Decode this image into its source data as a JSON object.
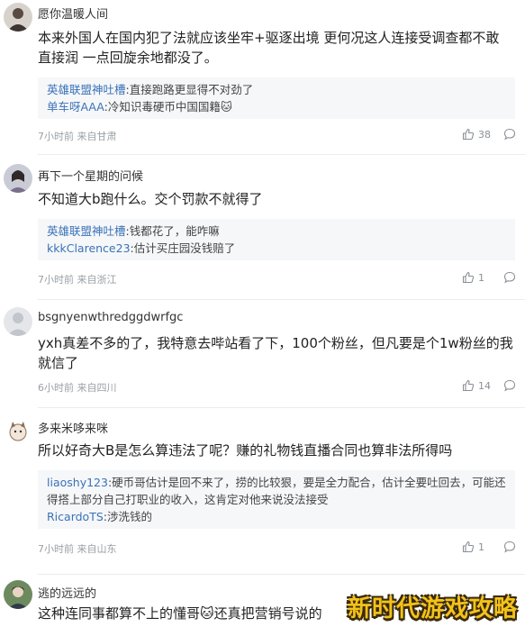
{
  "comments": [
    {
      "username": "愿你温暖人间",
      "text": "本来外国人在国内犯了法就应该坐牢+驱逐出境 更何况这人连接受调查都不敢 直接润 一点回旋余地都没了。",
      "replies": [
        {
          "name": "英雄联盟神吐槽",
          "text": ":直接跑路更显得不对劲了"
        },
        {
          "name": "单车呀AAA",
          "text": ":冷知识毒硬币中国国籍🐱"
        }
      ],
      "meta": "7小时前 来自甘肃",
      "likes": "38"
    },
    {
      "username": "再下一个星期的问候",
      "text": "不知道大b跑什么。交个罚款不就得了",
      "replies": [
        {
          "name": "英雄联盟神吐槽",
          "text": ":钱都花了，能咋嘛"
        },
        {
          "name": "kkkClarence23",
          "text": ":估计买庄园没钱赔了"
        }
      ],
      "meta": "7小时前 来自浙江",
      "likes": "1"
    },
    {
      "username": "bsgnyenwthredggdwrfgc",
      "text": "yxh真差不多的了，我特意去哔站看了下，100个粉丝，但凡要是个1w粉丝的我就信了",
      "replies": [],
      "meta": "6小时前 来自四川",
      "likes": "14"
    },
    {
      "username": "多来米哆来咪",
      "text": "所以好奇大B是怎么算违法了呢？赚的礼物钱直播合同也算非法所得吗",
      "replies": [
        {
          "name": "liaoshy123",
          "text": ":硬币哥估计是回不来了，捞的比较狠，要是全力配合，估计全要吐回去，可能还得搭上部分自己打职业的收入，这肯定对他来说没法接受"
        },
        {
          "name": "RicardoTS",
          "text": ":涉洗钱的"
        }
      ],
      "meta": "7小时前 来自山东",
      "likes": "1"
    },
    {
      "username": "逃的远远的",
      "text": "这种连同事都算不上的懂哥🐱还真把营销号说的",
      "replies": [],
      "meta": "",
      "likes": ""
    }
  ],
  "watermark": "新时代游戏攻略",
  "icons": {
    "like": "thumbs-up-icon",
    "comment": "comment-bubble-icon"
  },
  "colors": {
    "reply_name": "#3a72b8",
    "meta": "#9aa0a6",
    "reply_bg": "#f6f7f9",
    "watermark": "#f4c21a"
  }
}
